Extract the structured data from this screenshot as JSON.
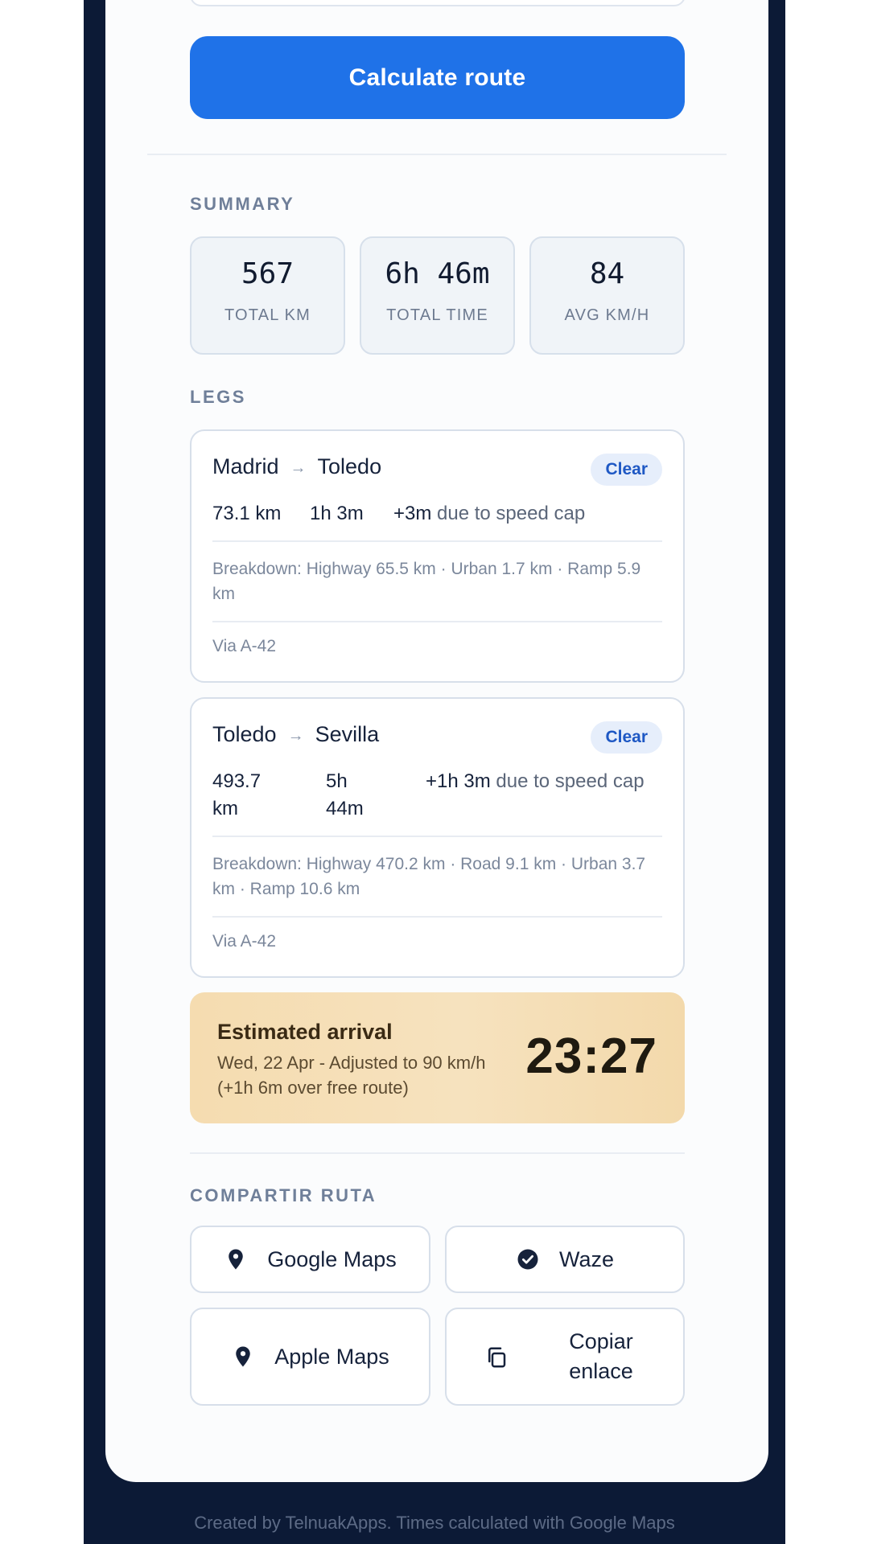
{
  "actions": {
    "calculate_label": "Calculate route"
  },
  "summary": {
    "label": "SUMMARY",
    "stats": [
      {
        "value": "567",
        "label": "TOTAL KM"
      },
      {
        "value": "6h 46m",
        "label": "TOTAL TIME"
      },
      {
        "value": "84",
        "label": "AVG KM/H"
      }
    ]
  },
  "legs": {
    "label": "LEGS",
    "items": [
      {
        "from": "Madrid",
        "arrow": "→",
        "to": "Toledo",
        "clear_label": "Clear",
        "distance": "73.1 km",
        "duration": "1h 3m",
        "delay": "+3m",
        "delay_suffix": "due to speed cap",
        "breakdown": "Breakdown: Highway 65.5 km · Urban 1.7 km · Ramp 5.9 km",
        "via": "Via A-42"
      },
      {
        "from": "Toledo",
        "arrow": "→",
        "to": "Sevilla",
        "clear_label": "Clear",
        "distance": "493.7 km",
        "duration": "5h 44m",
        "delay": "+1h 3m",
        "delay_suffix": "due to speed cap",
        "breakdown": "Breakdown: Highway 470.2 km · Road 9.1 km · Urban 3.7 km · Ramp 10.6 km",
        "via": "Via A-42"
      }
    ]
  },
  "arrival": {
    "title": "Estimated arrival",
    "subtitle": "Wed, 22 Apr - Adjusted to 90 km/h (+1h 6m over free route)",
    "time": "23:27"
  },
  "share": {
    "label": "COMPARTIR RUTA",
    "buttons": [
      {
        "label": "Google Maps",
        "icon": "map-pin-icon"
      },
      {
        "label": "Waze",
        "icon": "check-circle-icon"
      },
      {
        "label": "Apple Maps",
        "icon": "map-pin-icon"
      },
      {
        "label": "Copiar enlace",
        "icon": "copy-icon"
      }
    ]
  },
  "footer": {
    "text": "Created by TelnuakApps. Times calculated with Google Maps"
  },
  "colors": {
    "primary": "#1f72e8",
    "frame": "#0c1a36",
    "arrival_bg": "#f5dcb0"
  }
}
